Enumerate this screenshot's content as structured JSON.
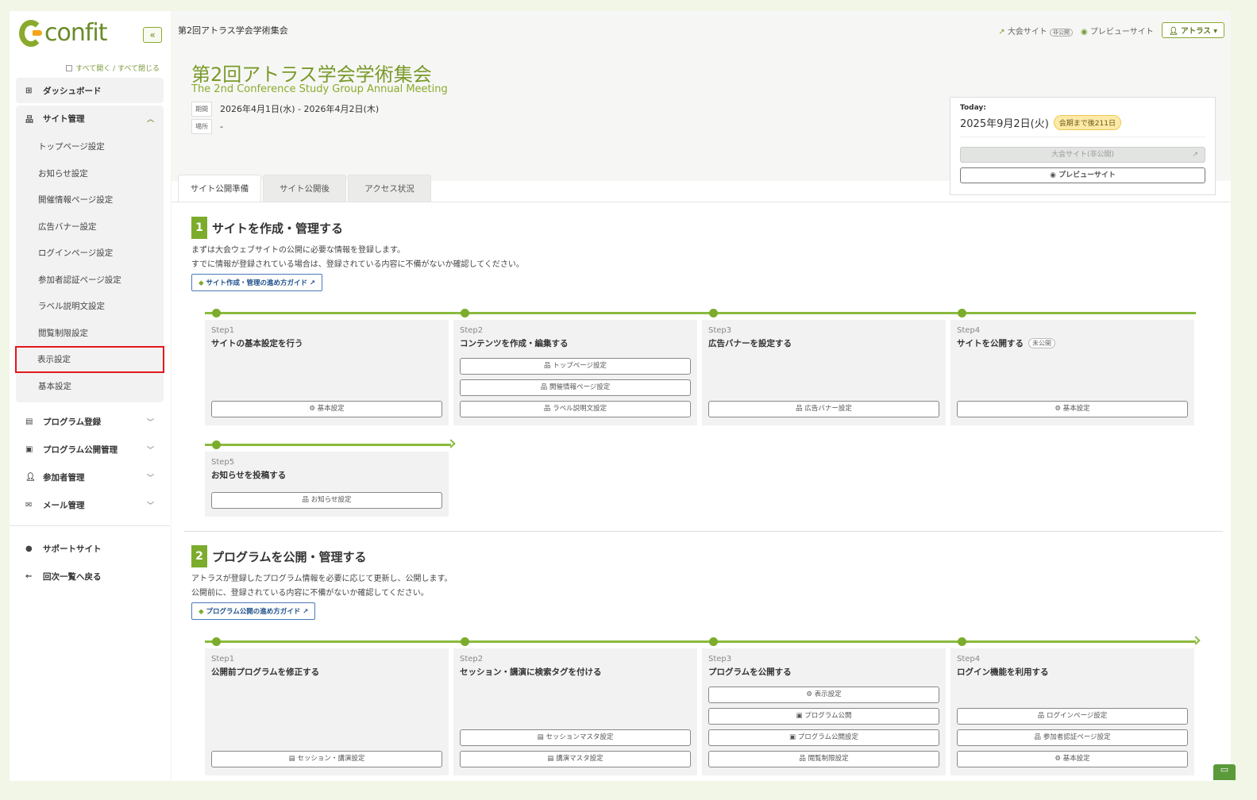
{
  "sidebar": {
    "logo_text": "confit",
    "collapse_icon": "«",
    "open_close_all": "すべて開く / すべて閉じる",
    "dashboard": "ダッシュボード",
    "site_management": "サイト管理",
    "site_items": [
      "トップページ設定",
      "お知らせ設定",
      "開催情報ページ設定",
      "広告バナー設定",
      "ログインページ設定",
      "参加者認証ページ設定",
      "ラベル説明文設定",
      "閲覧制限設定",
      "表示設定",
      "基本設定"
    ],
    "highlighted_index": 8,
    "groups": [
      "プログラム登録",
      "プログラム公開管理",
      "参加者管理",
      "メール管理"
    ],
    "support": "サポートサイト",
    "back": "回次一覧へ戻る"
  },
  "topbar": {
    "breadcrumb": "第2回アトラス学会学術集会",
    "conference_site": "大会サイト",
    "private_badge": "非公開",
    "preview_site": "プレビューサイト",
    "user": "アトラス"
  },
  "header": {
    "title": "第2回アトラス学会学術集会",
    "subtitle": "The 2nd Conference Study Group Annual Meeting",
    "period_label": "期間",
    "period": "2026年4月1日(水) - 2026年4月2日(木)",
    "place_label": "場所",
    "place": "-"
  },
  "today": {
    "label": "Today:",
    "date": "2025年9月2日(火)",
    "countdown": "会期まで後211日",
    "site_button": "大会サイト(非公開)",
    "preview_button": "プレビューサイト"
  },
  "tabs": [
    "サイト公開準備",
    "サイト公開後",
    "アクセス状況"
  ],
  "sections": [
    {
      "num": "1",
      "title": "サイトを作成・管理する",
      "desc": [
        "まずは大会ウェブサイトの公開に必要な情報を登録します。",
        "すでに情報が登録されている場合は、登録されている内容に不備がないか確認してください。"
      ],
      "guide": "サイト作成・管理の進め方ガイド",
      "steps": [
        {
          "step": "Step1",
          "title": "サイトの基本設定を行う",
          "buttons": [
            {
              "icon": "⚙",
              "label": "基本設定"
            }
          ]
        },
        {
          "step": "Step2",
          "title": "コンテンツを作成・編集する",
          "buttons": [
            {
              "icon": "品",
              "label": "トップページ設定"
            },
            {
              "icon": "品",
              "label": "開催情報ページ設定"
            },
            {
              "icon": "品",
              "label": "ラベル説明文設定"
            }
          ]
        },
        {
          "step": "Step3",
          "title": "広告バナーを設定する",
          "buttons": [
            {
              "icon": "品",
              "label": "広告バナー設定"
            }
          ]
        },
        {
          "step": "Step4",
          "title": "サイトを公開する",
          "status": "未公開",
          "buttons": [
            {
              "icon": "⚙",
              "label": "基本設定"
            }
          ]
        },
        {
          "step": "Step5",
          "title": "お知らせを投稿する",
          "buttons": [
            {
              "icon": "品",
              "label": "お知らせ設定"
            }
          ]
        }
      ]
    },
    {
      "num": "2",
      "title": "プログラムを公開・管理する",
      "desc": [
        "アトラスが登録したプログラム情報を必要に応じて更新し、公開します。",
        "公開前に、登録されている内容に不備がないか確認してください。"
      ],
      "guide": "プログラム公開の進め方ガイド",
      "steps": [
        {
          "step": "Step1",
          "title": "公開前プログラムを修正する",
          "buttons": [
            {
              "icon": "▤",
              "label": "セッション・講演設定"
            }
          ]
        },
        {
          "step": "Step2",
          "title": "セッション・講演に検索タグを付ける",
          "buttons": [
            {
              "icon": "▤",
              "label": "セッションマスタ設定"
            },
            {
              "icon": "▤",
              "label": "講演マスタ設定"
            }
          ]
        },
        {
          "step": "Step3",
          "title": "プログラムを公開する",
          "buttons": [
            {
              "icon": "⚙",
              "label": "表示設定"
            },
            {
              "icon": "▣",
              "label": "プログラム公開"
            },
            {
              "icon": "▣",
              "label": "プログラム公開設定"
            },
            {
              "icon": "品",
              "label": "閲覧制限設定"
            }
          ]
        },
        {
          "step": "Step4",
          "title": "ログイン機能を利用する",
          "buttons": [
            {
              "icon": "品",
              "label": "ログインページ設定"
            },
            {
              "icon": "品",
              "label": "参加者認証ページ設定"
            },
            {
              "icon": "⚙",
              "label": "基本設定"
            }
          ]
        }
      ]
    }
  ],
  "colors": {
    "accent": "#7cac2c",
    "highlight": "#e0191f",
    "guide": "#1d4e8a"
  }
}
